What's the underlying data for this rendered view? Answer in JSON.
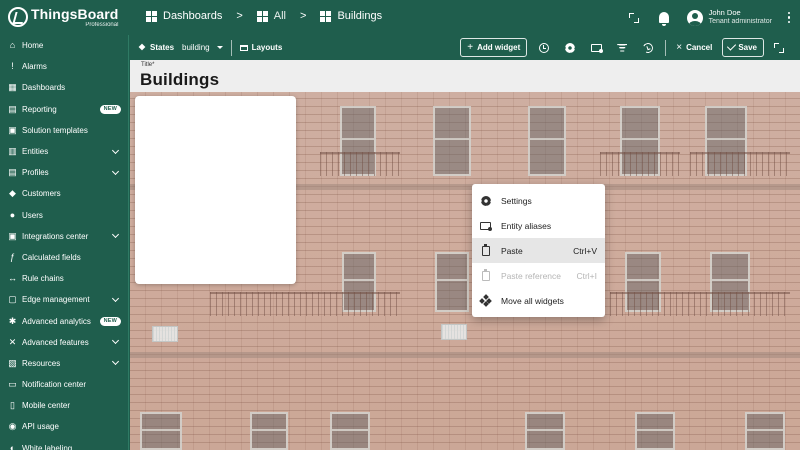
{
  "app": {
    "logo_name": "ThingsBoard",
    "logo_sub": "Professional"
  },
  "breadcrumb": [
    {
      "label": "Dashboards",
      "icon": "dashboards-icon"
    },
    {
      "label": "All",
      "icon": "dashboards-icon"
    },
    {
      "label": "Buildings",
      "icon": "dashboards-icon"
    }
  ],
  "breadcrumb_sep": ">",
  "user": {
    "name": "John Doe",
    "role": "Tenant administrator"
  },
  "sidebar": {
    "items": [
      {
        "label": "Home",
        "icon": "home-icon"
      },
      {
        "label": "Alarms",
        "icon": "alarms-icon"
      },
      {
        "label": "Dashboards",
        "icon": "dashboards-icon"
      },
      {
        "label": "Reporting",
        "icon": "reporting-icon",
        "badge": "NEW"
      },
      {
        "label": "Solution templates",
        "icon": "solution-templates-icon"
      },
      {
        "label": "Entities",
        "icon": "entities-icon",
        "expandable": true
      },
      {
        "label": "Profiles",
        "icon": "profiles-icon",
        "expandable": true
      },
      {
        "label": "Customers",
        "icon": "customers-icon"
      },
      {
        "label": "Users",
        "icon": "users-icon"
      },
      {
        "label": "Integrations center",
        "icon": "integrations-icon",
        "expandable": true
      },
      {
        "label": "Calculated fields",
        "icon": "calculated-fields-icon"
      },
      {
        "label": "Rule chains",
        "icon": "rule-chains-icon"
      },
      {
        "label": "Edge management",
        "icon": "edge-icon",
        "expandable": true
      },
      {
        "label": "Advanced analytics",
        "icon": "analytics-icon",
        "badge": "NEW"
      },
      {
        "label": "Advanced features",
        "icon": "advanced-features-icon",
        "expandable": true
      },
      {
        "label": "Resources",
        "icon": "resources-icon",
        "expandable": true
      },
      {
        "label": "Notification center",
        "icon": "notification-center-icon"
      },
      {
        "label": "Mobile center",
        "icon": "mobile-center-icon"
      },
      {
        "label": "API usage",
        "icon": "api-usage-icon"
      },
      {
        "label": "White labeling",
        "icon": "white-labeling-icon"
      }
    ]
  },
  "toolbar": {
    "states_label": "States",
    "state_value": "building",
    "layouts_label": "Layouts",
    "add_widget_label": "Add widget",
    "cancel_label": "Cancel",
    "save_label": "Save"
  },
  "dashboard": {
    "title_label": "Title*",
    "title_value": "Buildings"
  },
  "context_menu": {
    "items": [
      {
        "label": "Settings",
        "shortcut": "",
        "icon": "settings-icon",
        "disabled": false,
        "highlighted": false
      },
      {
        "label": "Entity aliases",
        "shortcut": "",
        "icon": "entity-aliases-icon",
        "disabled": false,
        "highlighted": false
      },
      {
        "label": "Paste",
        "shortcut": "Ctrl+V",
        "icon": "paste-icon",
        "disabled": false,
        "highlighted": true
      },
      {
        "label": "Paste reference",
        "shortcut": "Ctrl+I",
        "icon": "paste-reference-icon",
        "disabled": true,
        "highlighted": false
      },
      {
        "label": "Move all widgets",
        "shortcut": "",
        "icon": "move-all-icon",
        "disabled": false,
        "highlighted": false
      }
    ]
  },
  "colors": {
    "brand": "#1f5e4d",
    "menu_highlight": "#e6e6e6",
    "disabled_text": "#b5b5b5"
  }
}
